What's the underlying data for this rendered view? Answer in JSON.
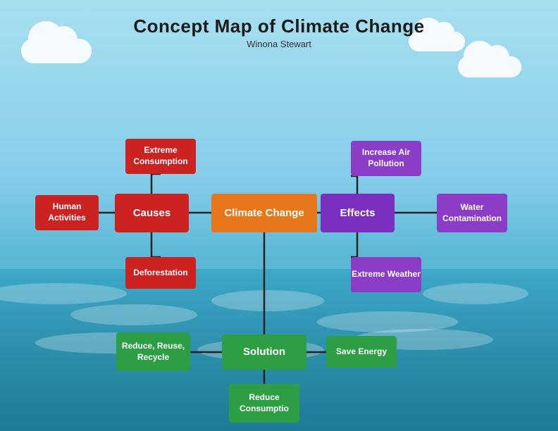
{
  "title": "Concept Map of Climate Change",
  "author": "Winona Stewart",
  "boxes": {
    "climate_change": "Climate Change",
    "causes": "Causes",
    "human_activities": "Human Activities",
    "extreme_consumption": "Extreme Consumption",
    "deforestation": "Deforestation",
    "effects": "Effects",
    "increase_air_pollution": "Increase Air Pollution",
    "water_contamination": "Water Contamination",
    "extreme_weather": "Extreme Weather",
    "solution": "Solution",
    "reduce_reuse_recycle": "Reduce, Reuse, Recycle",
    "save_energy": "Save Energy",
    "reduce_consumption": "Reduce Consumptio"
  },
  "colors": {
    "orange": "#E8761A",
    "red": "#CC2222",
    "purple": "#7B2FBE",
    "green": "#2E9E45"
  }
}
